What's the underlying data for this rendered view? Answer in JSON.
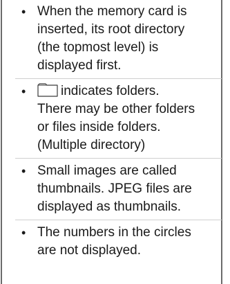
{
  "items": [
    {
      "lines": [
        "When the memory card is",
        "inserted, its root directory",
        "(the topmost level) is",
        "displayed first."
      ]
    },
    {
      "icon": "folder-icon",
      "first_line_after_icon": "indicates folders.",
      "lines": [
        "There may be other folders",
        "or files inside folders.",
        "(Multiple directory)"
      ]
    },
    {
      "lines": [
        "Small images are called",
        "thumbnails. JPEG files are",
        "displayed as thumbnails."
      ]
    },
    {
      "lines": [
        "The numbers in the circles",
        "are not displayed."
      ]
    }
  ]
}
